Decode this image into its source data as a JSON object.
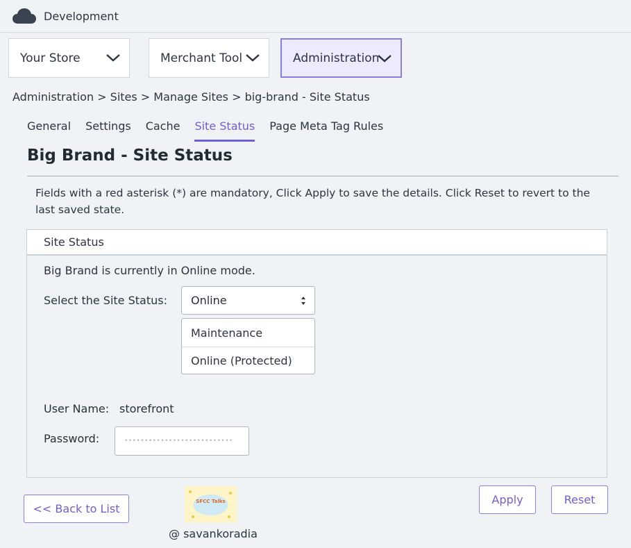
{
  "header": {
    "env_name": "Development",
    "cloud_icon": "cloud-icon"
  },
  "nav": {
    "your_store": "Your Store",
    "merchant_tool": "Merchant Tool",
    "administration": "Administration"
  },
  "breadcrumb": "Administration > Sites > Manage Sites > big-brand - Site Status",
  "tabs": [
    "General",
    "Settings",
    "Cache",
    "Site Status",
    "Page Meta Tag Rules"
  ],
  "active_tab": "Site Status",
  "page_title": "Big Brand - Site Status",
  "hint": "Fields with a red asterisk (*) are mandatory, Click Apply to save the details. Click Reset to revert to the last saved state.",
  "panel": {
    "title": "Site Status",
    "status_message": "Big Brand is currently in Online mode.",
    "select_label": "Select the Site Status:",
    "selected_value": "Online",
    "options": [
      "Maintenance",
      "Online (Protected)"
    ],
    "user_name_label": "User Name:",
    "user_name_value": "storefront",
    "password_label": "Password:",
    "password_placeholder": "•••••••••••••••••••••••••••"
  },
  "buttons": {
    "back": "<< Back to List",
    "apply": "Apply",
    "reset": "Reset"
  },
  "watermark": {
    "logo_text": "SFCC Talks",
    "handle": "@ savankoradia"
  },
  "colors": {
    "accent": "#6d5fd6",
    "active_nav_bg": "#eceafc",
    "page_bg": "#f0f3f6"
  }
}
